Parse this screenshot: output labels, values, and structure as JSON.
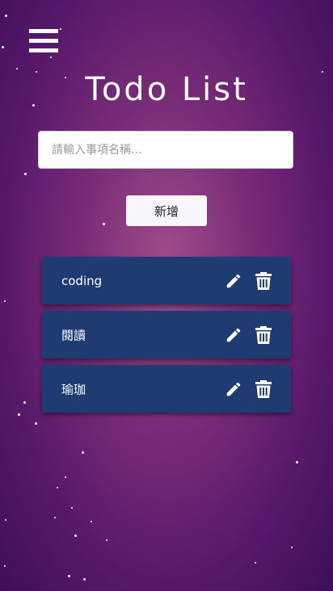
{
  "header": {
    "menu_icon": "hamburger-menu-icon",
    "title": "Todo List"
  },
  "form": {
    "placeholder": "請輸入事項名稱...",
    "value": "",
    "add_label": "新增"
  },
  "todos": [
    {
      "text": "coding",
      "edit_icon": "pencil-icon",
      "delete_icon": "trash-icon"
    },
    {
      "text": "閱讀",
      "edit_icon": "pencil-icon",
      "delete_icon": "trash-icon"
    },
    {
      "text": "瑜珈",
      "edit_icon": "pencil-icon",
      "delete_icon": "trash-icon"
    }
  ],
  "colors": {
    "background_center": "#a24d8c",
    "background_edge": "#3f0f58",
    "todo_card": "#1e3b72",
    "text": "#ffffff",
    "button_bg": "#f7f7f9"
  }
}
